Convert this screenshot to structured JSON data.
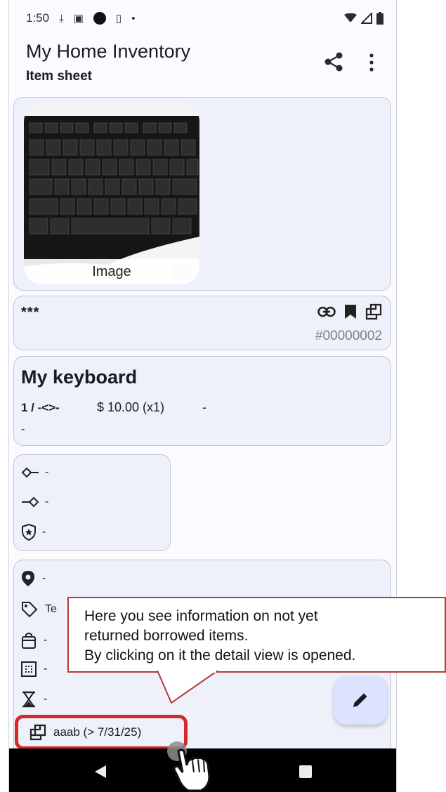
{
  "status_bar": {
    "time": "1:50"
  },
  "app_bar": {
    "title": "My Home Inventory",
    "subtitle": "Item sheet",
    "share_icon": "share-icon",
    "more_icon": "more-vert-icon"
  },
  "image_card": {
    "caption": "Image"
  },
  "meta_card": {
    "rating": "***",
    "id": "#00000002",
    "icons": [
      "link-icon",
      "bookmark-icon",
      "borrow-icon"
    ]
  },
  "item": {
    "name": "My keyboard",
    "quantity": "1 / -<>-",
    "price": "$ 10.00 (x1)",
    "extra": "-",
    "description": "-"
  },
  "attributes": [
    {
      "icon": "diamond-left-icon",
      "value": "-"
    },
    {
      "icon": "diamond-right-icon",
      "value": "-"
    },
    {
      "icon": "star-shield-icon",
      "value": "-"
    }
  ],
  "location": [
    {
      "icon": "location-pin-icon",
      "value": "-"
    },
    {
      "icon": "tag-icon",
      "value": "Te"
    },
    {
      "icon": "bag-icon",
      "value": "-"
    },
    {
      "icon": "grid-icon",
      "value": "-"
    },
    {
      "icon": "hourglass-icon",
      "value": "-"
    }
  ],
  "borrow": {
    "label": "aaab (> 7/31/25)"
  },
  "callout": {
    "lines": [
      "Here you see information on not yet",
      "returned borrowed items.",
      "By clicking on it the detail view is opened."
    ]
  },
  "colors": {
    "card_bg": "#eef0fa",
    "card_border": "#c3c7d3",
    "highlight": "#d42a2a",
    "fab_bg": "#dbe3ff",
    "callout_border": "#b33a3a"
  }
}
